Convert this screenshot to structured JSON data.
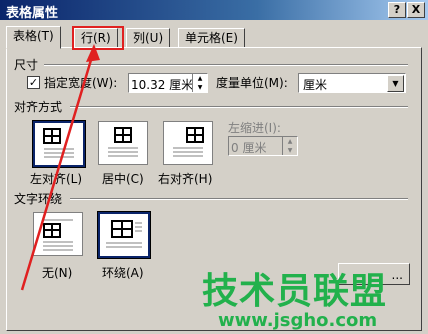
{
  "window": {
    "title": "表格属性",
    "help_glyph": "?",
    "close_glyph": "X"
  },
  "tabs": [
    {
      "label": "表格(T)",
      "active": true
    },
    {
      "label": "行(R)",
      "active": false
    },
    {
      "label": "列(U)",
      "active": false
    },
    {
      "label": "单元格(E)",
      "active": false
    }
  ],
  "size": {
    "heading": "尺寸",
    "preferred_width_label": "指定宽度(W):",
    "preferred_width_checked": true,
    "width_value": "10.32 厘米",
    "measure_label": "度量单位(M):",
    "measure_value": "厘米"
  },
  "alignment": {
    "heading": "对齐方式",
    "options": [
      {
        "label": "左对齐(L)",
        "selected": true
      },
      {
        "label": "居中(C)",
        "selected": false
      },
      {
        "label": "右对齐(H)",
        "selected": false
      }
    ],
    "indent_label": "左缩进(I):",
    "indent_value": "0 厘米"
  },
  "wrapping": {
    "heading": "文字环绕",
    "options": [
      {
        "label": "无(N)",
        "selected": false
      },
      {
        "label": "环绕(A)",
        "selected": true
      }
    ],
    "positioning_button": "..."
  },
  "watermark": {
    "brand": "技术员联盟",
    "url": "www.jsgho.com"
  },
  "colors": {
    "titlebar": "#0a246a",
    "highlight": "#e02020",
    "watermark": "#22b14c"
  }
}
